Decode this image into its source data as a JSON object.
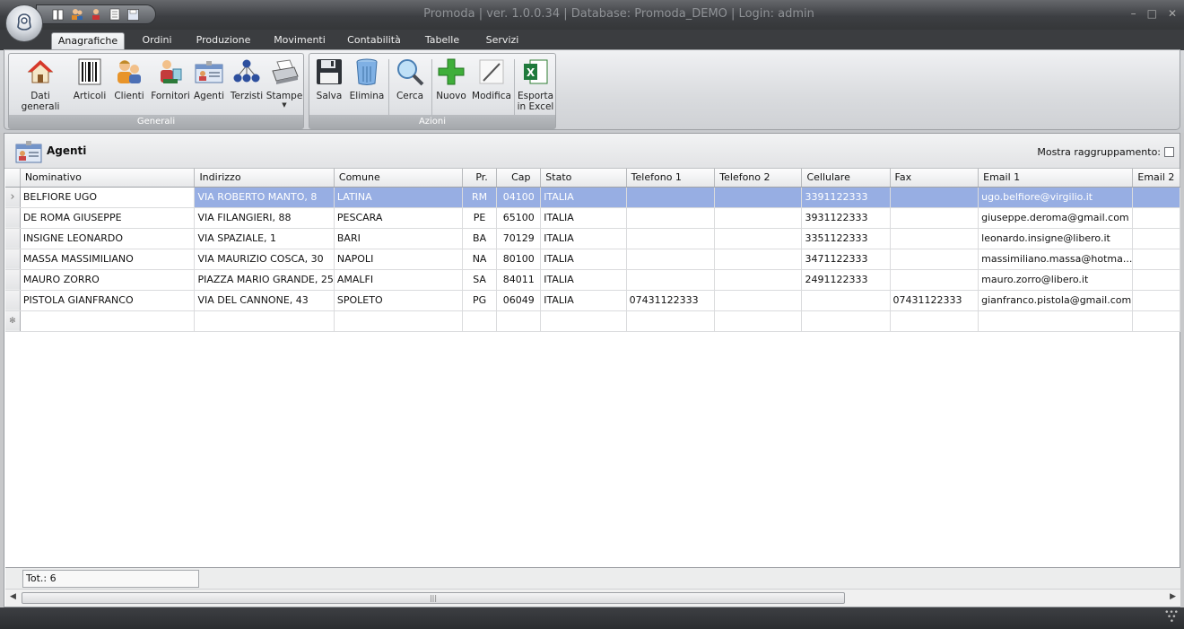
{
  "window": {
    "title": "Promoda | ver. 1.0.0.34 | Database: Promoda_DEMO | Login: admin",
    "minimize_icon": "minimize-icon",
    "maximize_icon": "maximize-icon",
    "close_icon": "close-icon"
  },
  "quick_access": [
    "book-icon",
    "users-icon",
    "customer-icon",
    "document-icon",
    "save-icon"
  ],
  "tabs": [
    "Anagrafiche",
    "Ordini",
    "Produzione",
    "Movimenti",
    "Contabilità",
    "Tabelle",
    "Servizi"
  ],
  "active_tab": "Anagrafiche",
  "ribbon": {
    "groups": [
      {
        "caption": "Generali",
        "buttons": [
          {
            "label": "Dati generali",
            "icon": "house-icon"
          },
          {
            "label": "Articoli",
            "icon": "barcode-icon"
          },
          {
            "label": "Clienti",
            "icon": "clients-icon"
          },
          {
            "label": "Fornitori",
            "icon": "suppliers-icon"
          },
          {
            "label": "Agenti",
            "icon": "id-card-icon"
          },
          {
            "label": "Terzisti",
            "icon": "org-chart-icon"
          },
          {
            "label": "Stampe",
            "icon": "printer-icon"
          }
        ]
      },
      {
        "caption": "Azioni",
        "buttons": [
          {
            "label": "Salva",
            "icon": "floppy-icon"
          },
          {
            "label": "Elimina",
            "icon": "trash-icon"
          },
          {
            "label": "Cerca",
            "icon": "magnifier-icon"
          },
          {
            "label": "Nuovo",
            "icon": "plus-icon"
          },
          {
            "label": "Modifica",
            "icon": "pencil-icon"
          },
          {
            "label": "Esporta in Excel",
            "label_line1": "Esporta",
            "label_line2": "in Excel",
            "icon": "excel-icon"
          }
        ]
      }
    ]
  },
  "panel": {
    "title": "Agenti",
    "grouping_label": "Mostra raggruppamento:",
    "grouping_checked": false
  },
  "grid": {
    "columns": [
      "Nominativo",
      "Indirizzo",
      "Comune",
      "Pr.",
      "Cap",
      "Stato",
      "Telefono 1",
      "Telefono 2",
      "Cellulare",
      "Fax",
      "Email 1",
      "Email 2"
    ],
    "rows": [
      [
        "BELFIORE UGO",
        "VIA ROBERTO MANTO, 8",
        "LATINA",
        "RM",
        "04100",
        "ITALIA",
        "",
        "",
        "3391122333",
        "",
        "ugo.belfiore@virgilio.it",
        ""
      ],
      [
        "DE ROMA GIUSEPPE",
        "VIA FILANGIERI, 88",
        "PESCARA",
        "PE",
        "65100",
        "ITALIA",
        "",
        "",
        "3931122333",
        "",
        "giuseppe.deroma@gmail.com",
        ""
      ],
      [
        "INSIGNE LEONARDO",
        "VIA SPAZIALE, 1",
        "BARI",
        "BA",
        "70129",
        "ITALIA",
        "",
        "",
        "3351122333",
        "",
        "leonardo.insigne@libero.it",
        ""
      ],
      [
        "MASSA MASSIMILIANO",
        "VIA MAURIZIO COSCA, 30",
        "NAPOLI",
        "NA",
        "80100",
        "ITALIA",
        "",
        "",
        "3471122333",
        "",
        "massimiliano.massa@hotma...",
        ""
      ],
      [
        "MAURO ZORRO",
        "PIAZZA MARIO GRANDE, 25",
        "AMALFI",
        "SA",
        "84011",
        "ITALIA",
        "",
        "",
        "2491122333",
        "",
        "mauro.zorro@libero.it",
        ""
      ],
      [
        "PISTOLA GIANFRANCO",
        "VIA DEL CANNONE, 43",
        "SPOLETO",
        "PG",
        "06049",
        "ITALIA",
        "07431122333",
        "",
        "",
        "07431122333",
        "gianfranco.pistola@gmail.com",
        ""
      ]
    ],
    "selected_row": 0,
    "total_label": "Tot.: 6"
  },
  "colors": {
    "selected_row": "#97aee3",
    "titlebar": "#3d3f43",
    "ribbon": "#e1e3e6"
  }
}
